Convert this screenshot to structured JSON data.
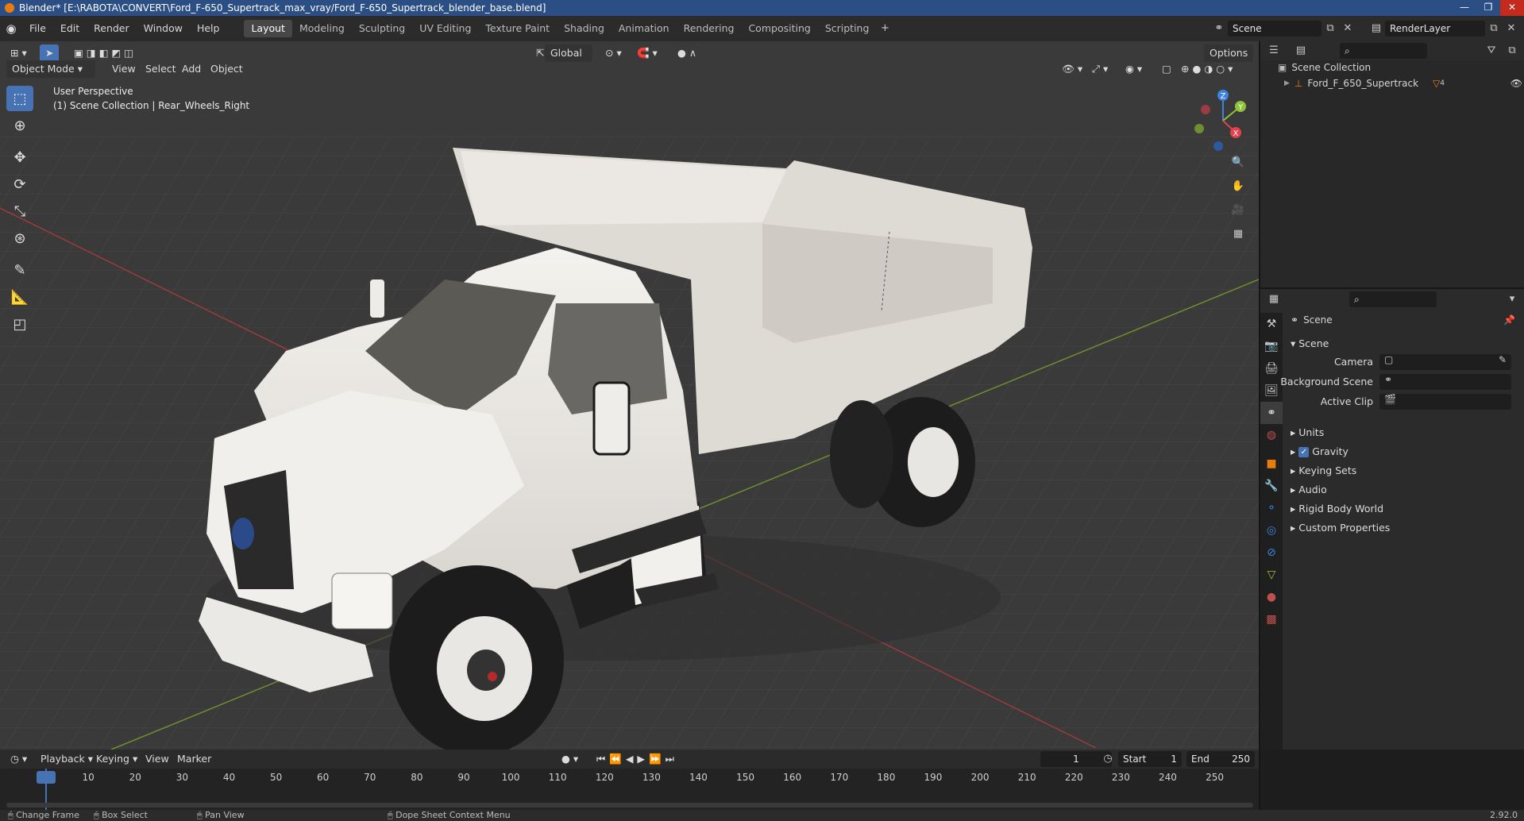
{
  "titlebar": {
    "title": "Blender* [E:\\RABOTA\\CONVERT\\Ford_F-650_Supertrack_max_vray/Ford_F-650_Supertrack_blender_base.blend]",
    "minimize": "—",
    "maximize": "❐",
    "close": "✕"
  },
  "menus": [
    "File",
    "Edit",
    "Render",
    "Window",
    "Help"
  ],
  "workspaces": [
    "Layout",
    "Modeling",
    "Sculpting",
    "UV Editing",
    "Texture Paint",
    "Shading",
    "Animation",
    "Rendering",
    "Compositing",
    "Scripting"
  ],
  "scene_field": "Scene",
  "render_layer_field": "RenderLayer",
  "viewport": {
    "mode": "Object Mode",
    "menus": [
      "View",
      "Select",
      "Add",
      "Object"
    ],
    "transform_orientation": "Global",
    "options": "Options",
    "overlay_line1": "User Perspective",
    "overlay_line2": "(1) Scene Collection | Rear_Wheels_Right",
    "gizmo": {
      "z": "Z",
      "y": "Y",
      "x": "X"
    }
  },
  "outliner": {
    "root": "Scene Collection",
    "items": [
      {
        "label": "Ford_F_650_Supertrack",
        "badge": "4"
      }
    ]
  },
  "properties": {
    "header": "Scene",
    "panel": "Scene",
    "fields": [
      {
        "label": "Camera",
        "value": ""
      },
      {
        "label": "Background Scene",
        "value": ""
      },
      {
        "label": "Active Clip",
        "value": ""
      }
    ],
    "sections": [
      "Units",
      "Gravity",
      "Keying Sets",
      "Audio",
      "Rigid Body World",
      "Custom Properties"
    ],
    "gravity_checked": true
  },
  "timeline": {
    "menus": [
      "Playback",
      "Keying",
      "View",
      "Marker"
    ],
    "current_frame": "1",
    "start_label": "Start",
    "start": "1",
    "end_label": "End",
    "end": "250",
    "ticks": [
      "1",
      "10",
      "20",
      "30",
      "40",
      "50",
      "60",
      "70",
      "80",
      "90",
      "100",
      "110",
      "120",
      "130",
      "140",
      "150",
      "160",
      "170",
      "180",
      "190",
      "200",
      "210",
      "220",
      "230",
      "240",
      "250"
    ]
  },
  "statusbar": {
    "items": [
      "Change Frame",
      "Box Select",
      "Pan View",
      "Dope Sheet Context Menu"
    ],
    "version": "2.92.0"
  },
  "colors": {
    "accent": "#4772b3",
    "x_axis": "#e5414d",
    "y_axis": "#8fc43a",
    "z_axis": "#3e82e0",
    "brand_orange": "#e87d0d"
  }
}
